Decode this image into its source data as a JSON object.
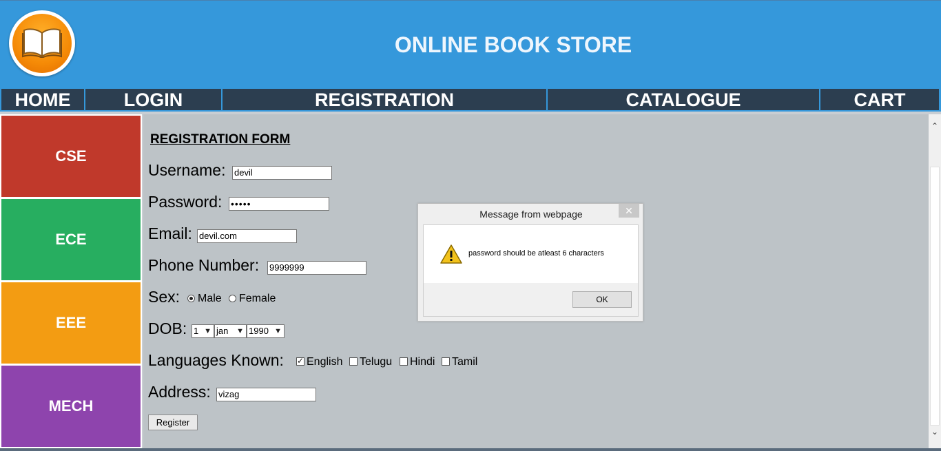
{
  "header": {
    "title": "ONLINE BOOK STORE",
    "logo_icon": "book-icon",
    "bg_color": "#3598db"
  },
  "nav": {
    "items": [
      {
        "label": "HOME"
      },
      {
        "label": "LOGIN"
      },
      {
        "label": "REGISTRATION"
      },
      {
        "label": "CATALOGUE"
      },
      {
        "label": "CART"
      }
    ],
    "bg_color": "#2c3e50"
  },
  "sidebar": {
    "items": [
      {
        "label": "CSE",
        "color": "#c0392b"
      },
      {
        "label": "ECE",
        "color": "#27ae60"
      },
      {
        "label": "EEE",
        "color": "#f39c12"
      },
      {
        "label": "MECH",
        "color": "#8e44ad"
      }
    ]
  },
  "form": {
    "title": "REGISTRATION FORM",
    "username": {
      "label": "Username:",
      "value": "devil"
    },
    "password": {
      "label": "Password:",
      "value": "•••••"
    },
    "email": {
      "label": "Email:",
      "value": "devil.com"
    },
    "phone": {
      "label": "Phone Number:",
      "value": "9999999"
    },
    "sex": {
      "label": "Sex:",
      "options": [
        "Male",
        "Female"
      ],
      "selected": "Male"
    },
    "dob": {
      "label": "DOB:",
      "day": "1",
      "month": "jan",
      "year": "1990"
    },
    "languages": {
      "label": "Languages Known:",
      "options": [
        "English",
        "Telugu",
        "Hindi",
        "Tamil"
      ],
      "checked": [
        "English"
      ]
    },
    "address": {
      "label": "Address:",
      "value": "vizag"
    },
    "submit_label": "Register"
  },
  "dialog": {
    "title": "Message from webpage",
    "message": "password should be atleast 6 characters",
    "ok_label": "OK",
    "icon": "warning-icon",
    "close_icon": "close-icon"
  }
}
